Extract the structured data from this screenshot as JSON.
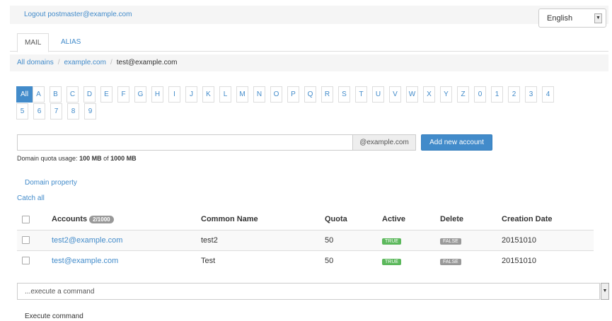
{
  "header": {
    "logout_label": "Logout postmaster@example.com",
    "language": "English"
  },
  "tabs": [
    {
      "label": "MAIL",
      "active": true
    },
    {
      "label": "ALIAS",
      "active": false
    }
  ],
  "breadcrumb": {
    "items": [
      "All domains",
      "example.com"
    ],
    "current": "test@example.com"
  },
  "letters": [
    "All",
    "A",
    "B",
    "C",
    "D",
    "E",
    "F",
    "G",
    "H",
    "I",
    "J",
    "K",
    "L",
    "M",
    "N",
    "O",
    "P",
    "Q",
    "R",
    "S",
    "T",
    "U",
    "V",
    "W",
    "X",
    "Y",
    "Z",
    "0",
    "1",
    "2",
    "3",
    "4",
    "5",
    "6",
    "7",
    "8",
    "9"
  ],
  "new_account": {
    "domain_suffix": "@example.com",
    "add_label": "Add new account"
  },
  "quota": {
    "prefix": "Domain quota usage: ",
    "used": "100 MB",
    "of": " of ",
    "total": "1000 MB"
  },
  "links": {
    "domain_property": "Domain property",
    "catch_all": "Catch all"
  },
  "table": {
    "headers": {
      "accounts": "Accounts",
      "count": "2/1000",
      "common_name": "Common Name",
      "quota": "Quota",
      "active": "Active",
      "delete": "Delete",
      "creation_date": "Creation Date"
    },
    "rows": [
      {
        "account": "test2@example.com",
        "common_name": "test2",
        "quota": "50",
        "active": "TRUE",
        "delete": "FALSE",
        "creation_date": "20151010"
      },
      {
        "account": "test@example.com",
        "common_name": "Test",
        "quota": "50",
        "active": "TRUE",
        "delete": "FALSE",
        "creation_date": "20151010"
      }
    ]
  },
  "command": {
    "placeholder": "...execute a command",
    "execute_label": "Execute command"
  },
  "colors": {
    "primary": "#428bca",
    "success": "#5cb85c",
    "muted": "#999999"
  }
}
